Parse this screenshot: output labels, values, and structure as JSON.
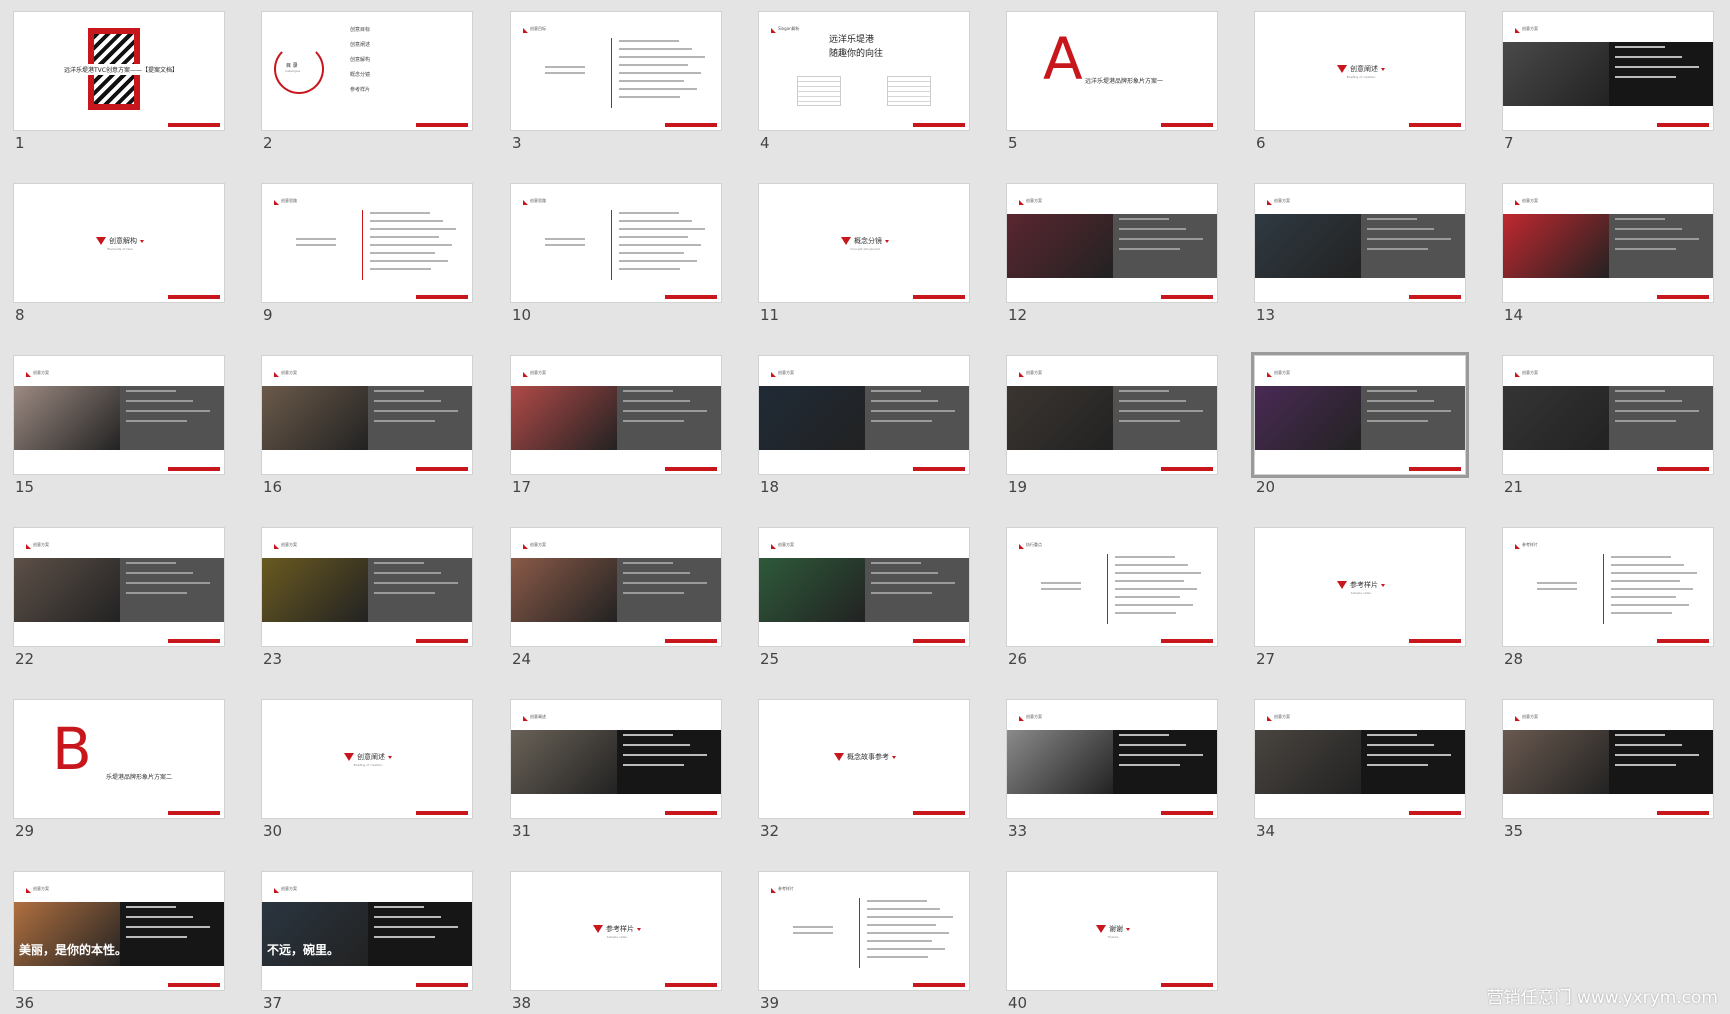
{
  "colors": {
    "accent": "#c8161d",
    "background": "#e4e4e4",
    "band": "#525252"
  },
  "selected_slide": "20",
  "watermark": "营销任意门 www.yxrym.com",
  "slides": [
    {
      "num": "1",
      "kind": "cover",
      "title": "远洋乐堤港TVC创意方案——【提案文档】"
    },
    {
      "num": "2",
      "kind": "catalogue",
      "title": "目 录",
      "subtitle": "Catalogue",
      "items": [
        "创意目标",
        "创意阐述",
        "创意解构",
        "概念分镜",
        "参考样片"
      ]
    },
    {
      "num": "3",
      "kind": "text",
      "header": "创意目标"
    },
    {
      "num": "4",
      "kind": "slogan",
      "header": "Slogan解析",
      "slogan_line1": "远洋乐堤港",
      "slogan_line2": "随趣你的向往"
    },
    {
      "num": "5",
      "kind": "letter",
      "letter": "A",
      "subtitle": "远洋乐堤港品牌形象片方案一"
    },
    {
      "num": "6",
      "kind": "divider",
      "label": "创意阐述",
      "sub": "Briefing of creation"
    },
    {
      "num": "7",
      "kind": "photo-dark",
      "header": "创意方案"
    },
    {
      "num": "8",
      "kind": "divider",
      "label": "创意解构",
      "sub": "Elements of idea"
    },
    {
      "num": "9",
      "kind": "text",
      "header": "创意思路"
    },
    {
      "num": "10",
      "kind": "text",
      "header": "创意思路"
    },
    {
      "num": "11",
      "kind": "divider",
      "label": "概念分镜",
      "sub": "Concept storyboard"
    },
    {
      "num": "12",
      "kind": "photo",
      "header": "创意方案",
      "photo": "#5a2630"
    },
    {
      "num": "13",
      "kind": "photo",
      "header": "创意方案",
      "photo": "#2f3a42"
    },
    {
      "num": "14",
      "kind": "photo",
      "header": "创意方案",
      "photo": "#c0282f"
    },
    {
      "num": "15",
      "kind": "photo",
      "header": "创意方案",
      "photo": "#9c8a82"
    },
    {
      "num": "16",
      "kind": "photo",
      "header": "创意方案",
      "photo": "#6b5a4a"
    },
    {
      "num": "17",
      "kind": "photo",
      "header": "创意方案",
      "photo": "#b04a48"
    },
    {
      "num": "18",
      "kind": "photo",
      "header": "创意方案",
      "photo": "#1f2a36"
    },
    {
      "num": "19",
      "kind": "photo",
      "header": "创意方案",
      "photo": "#3b3530"
    },
    {
      "num": "20",
      "kind": "photo",
      "header": "创意方案",
      "photo": "#4a2a55"
    },
    {
      "num": "21",
      "kind": "photo",
      "header": "创意方案",
      "photo": "#353535"
    },
    {
      "num": "22",
      "kind": "photo",
      "header": "创意方案",
      "photo": "#5d5048"
    },
    {
      "num": "23",
      "kind": "photo",
      "header": "创意方案",
      "photo": "#6a5a20"
    },
    {
      "num": "24",
      "kind": "photo",
      "header": "创意方案",
      "photo": "#8a5a48"
    },
    {
      "num": "25",
      "kind": "photo",
      "header": "创意方案",
      "photo": "#2e5a3a"
    },
    {
      "num": "26",
      "kind": "text",
      "header": "执行重点"
    },
    {
      "num": "27",
      "kind": "divider",
      "label": "参考样片",
      "sub": "Sample video"
    },
    {
      "num": "28",
      "kind": "text",
      "header": "参考样片"
    },
    {
      "num": "29",
      "kind": "letter",
      "letter": "B",
      "subtitle": "乐堤港品牌形象片方案二"
    },
    {
      "num": "30",
      "kind": "divider",
      "label": "创意阐述",
      "sub": "Briefing of creation"
    },
    {
      "num": "31",
      "kind": "photo-dark",
      "header": "创意阐述",
      "photo": "#6a6258"
    },
    {
      "num": "32",
      "kind": "divider",
      "label": "概念故事参考",
      "sub": ""
    },
    {
      "num": "33",
      "kind": "photo-dark",
      "header": "创意方案",
      "photo": "#8a8a8a",
      "caption": ""
    },
    {
      "num": "34",
      "kind": "photo-dark",
      "header": "创意方案",
      "photo": "#4a4540",
      "caption": ""
    },
    {
      "num": "35",
      "kind": "photo-dark",
      "header": "创意方案",
      "photo": "#6a5a50",
      "caption": ""
    },
    {
      "num": "36",
      "kind": "photo-dark",
      "header": "创意方案",
      "photo": "#b07040",
      "caption": "美丽，是你的本性。"
    },
    {
      "num": "37",
      "kind": "photo-dark",
      "header": "创意方案",
      "photo": "#2a3540",
      "caption": "不远，碗里。"
    },
    {
      "num": "38",
      "kind": "divider",
      "label": "参考样片",
      "sub": "Sample video"
    },
    {
      "num": "39",
      "kind": "text",
      "header": "参考样片"
    },
    {
      "num": "40",
      "kind": "divider",
      "label": "谢谢",
      "sub": "Thanks"
    }
  ]
}
